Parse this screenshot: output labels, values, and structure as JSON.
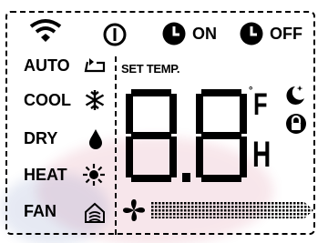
{
  "timers": {
    "on": "ON",
    "off": "OFF"
  },
  "modes": [
    {
      "label": "AUTO",
      "icon": "auto-cycle-icon"
    },
    {
      "label": "COOL",
      "icon": "snowflake-icon"
    },
    {
      "label": "DRY",
      "icon": "water-drop-icon"
    },
    {
      "label": "HEAT",
      "icon": "sun-heat-icon"
    },
    {
      "label": "FAN",
      "icon": "house-fan-icon"
    }
  ],
  "set_temp": {
    "label": "SET TEMP.",
    "display": "8.8"
  },
  "units": {
    "degree": "°",
    "temp_unit": "F",
    "hour_unit": "H"
  },
  "status_icons": [
    "wifi-icon",
    "power-icon",
    "timer-on-clock-icon",
    "timer-off-clock-icon",
    "sleep-moon-icon",
    "lock-icon",
    "fan-speed-icon"
  ],
  "colors": {
    "segment": "#000000",
    "background": "#ffffff"
  }
}
